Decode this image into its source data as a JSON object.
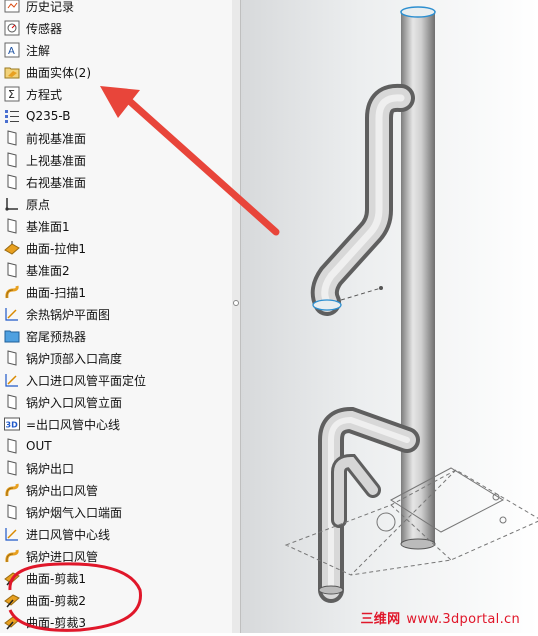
{
  "feature_tree": {
    "items": [
      {
        "label": "历史记录",
        "icon": "history-icon"
      },
      {
        "label": "传感器",
        "icon": "sensor-icon"
      },
      {
        "label": "注解",
        "icon": "annotation-icon"
      },
      {
        "label": "曲面实体(2)",
        "icon": "surface-bodies-folder-icon"
      },
      {
        "label": "方程式",
        "icon": "equations-icon"
      },
      {
        "label": "Q235-B",
        "icon": "material-icon"
      },
      {
        "label": "前视基准面",
        "icon": "plane-icon"
      },
      {
        "label": "上视基准面",
        "icon": "plane-icon"
      },
      {
        "label": "右视基准面",
        "icon": "plane-icon"
      },
      {
        "label": "原点",
        "icon": "origin-icon"
      },
      {
        "label": "基准面1",
        "icon": "plane-icon"
      },
      {
        "label": "曲面-拉伸1",
        "icon": "surface-extrude-icon"
      },
      {
        "label": "基准面2",
        "icon": "plane-icon"
      },
      {
        "label": "曲面-扫描1",
        "icon": "surface-sweep-icon"
      },
      {
        "label": "余热锅炉平面图",
        "icon": "sketch-icon"
      },
      {
        "label": "窑尾预热器",
        "icon": "folder-icon"
      },
      {
        "label": "锅炉顶部入口高度",
        "icon": "plane-icon"
      },
      {
        "label": "入口进口风管平面定位",
        "icon": "sketch-icon"
      },
      {
        "label": "锅炉入口风管立面",
        "icon": "plane-icon"
      },
      {
        "label": "=出口风管中心线",
        "icon": "3d-sketch-icon"
      },
      {
        "label": "OUT",
        "icon": "plane-icon"
      },
      {
        "label": "锅炉出口",
        "icon": "plane-icon"
      },
      {
        "label": "锅炉出口风管",
        "icon": "surface-sweep-icon"
      },
      {
        "label": "锅炉烟气入口端面",
        "icon": "plane-icon"
      },
      {
        "label": "进口风管中心线",
        "icon": "sketch-icon"
      },
      {
        "label": "锅炉进口风管",
        "icon": "surface-sweep-icon"
      },
      {
        "label": "曲面-剪裁1",
        "icon": "surface-trim-icon"
      },
      {
        "label": "曲面-剪裁2",
        "icon": "surface-trim-icon"
      },
      {
        "label": "曲面-剪裁3",
        "icon": "surface-trim-icon"
      }
    ]
  },
  "colors": {
    "annotation_red": "#e8453a",
    "circle_red": "#e0172a",
    "icon_orange": "#e8a020"
  },
  "watermark": {
    "zh": "三维网",
    "url": "www.3dportal.cn"
  }
}
